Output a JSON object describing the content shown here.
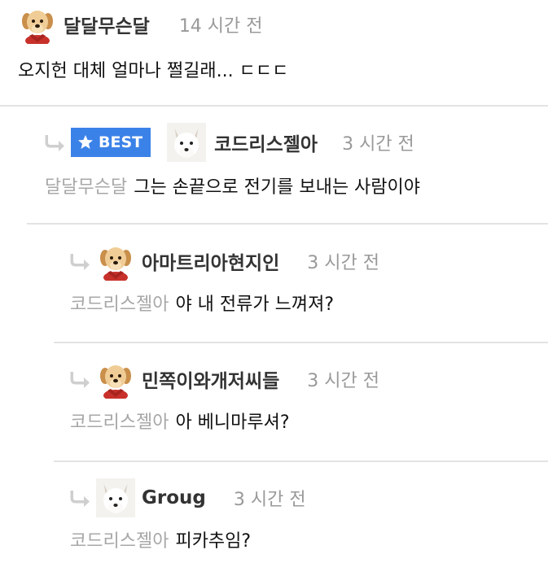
{
  "comments": [
    {
      "nickname": "달달무슨달",
      "time": "14 시간 전",
      "mention": "",
      "text": "오지헌 대체 얼마나 쩔길래... ㄷㄷㄷ",
      "avatar": "puppy-icon"
    },
    {
      "nickname": "코드리스젤아",
      "time": "3 시간 전",
      "badge": "BEST",
      "mention": "달달무슨달",
      "text": "그는 손끝으로 전기를 보내는 사람이야",
      "avatar": "white-fox-icon"
    },
    {
      "nickname": "아마트리아현지인",
      "time": "3 시간 전",
      "mention": "코드리스젤아",
      "text": "야 내 전류가 느껴져?",
      "avatar": "puppy-icon"
    },
    {
      "nickname": "민쪽이와개저씨들",
      "time": "3 시간 전",
      "mention": "코드리스젤아",
      "text": "아 베니마루셔?",
      "avatar": "puppy-icon"
    },
    {
      "nickname": "Groug",
      "time": "3 시간 전",
      "mention": "코드리스젤아",
      "text": "피카추임?",
      "avatar": "white-fox-icon"
    }
  ],
  "colors": {
    "best_badge": "#3b82e8",
    "mention": "#a7a7a7",
    "time": "#999999",
    "separator": "#e3e3e3"
  }
}
